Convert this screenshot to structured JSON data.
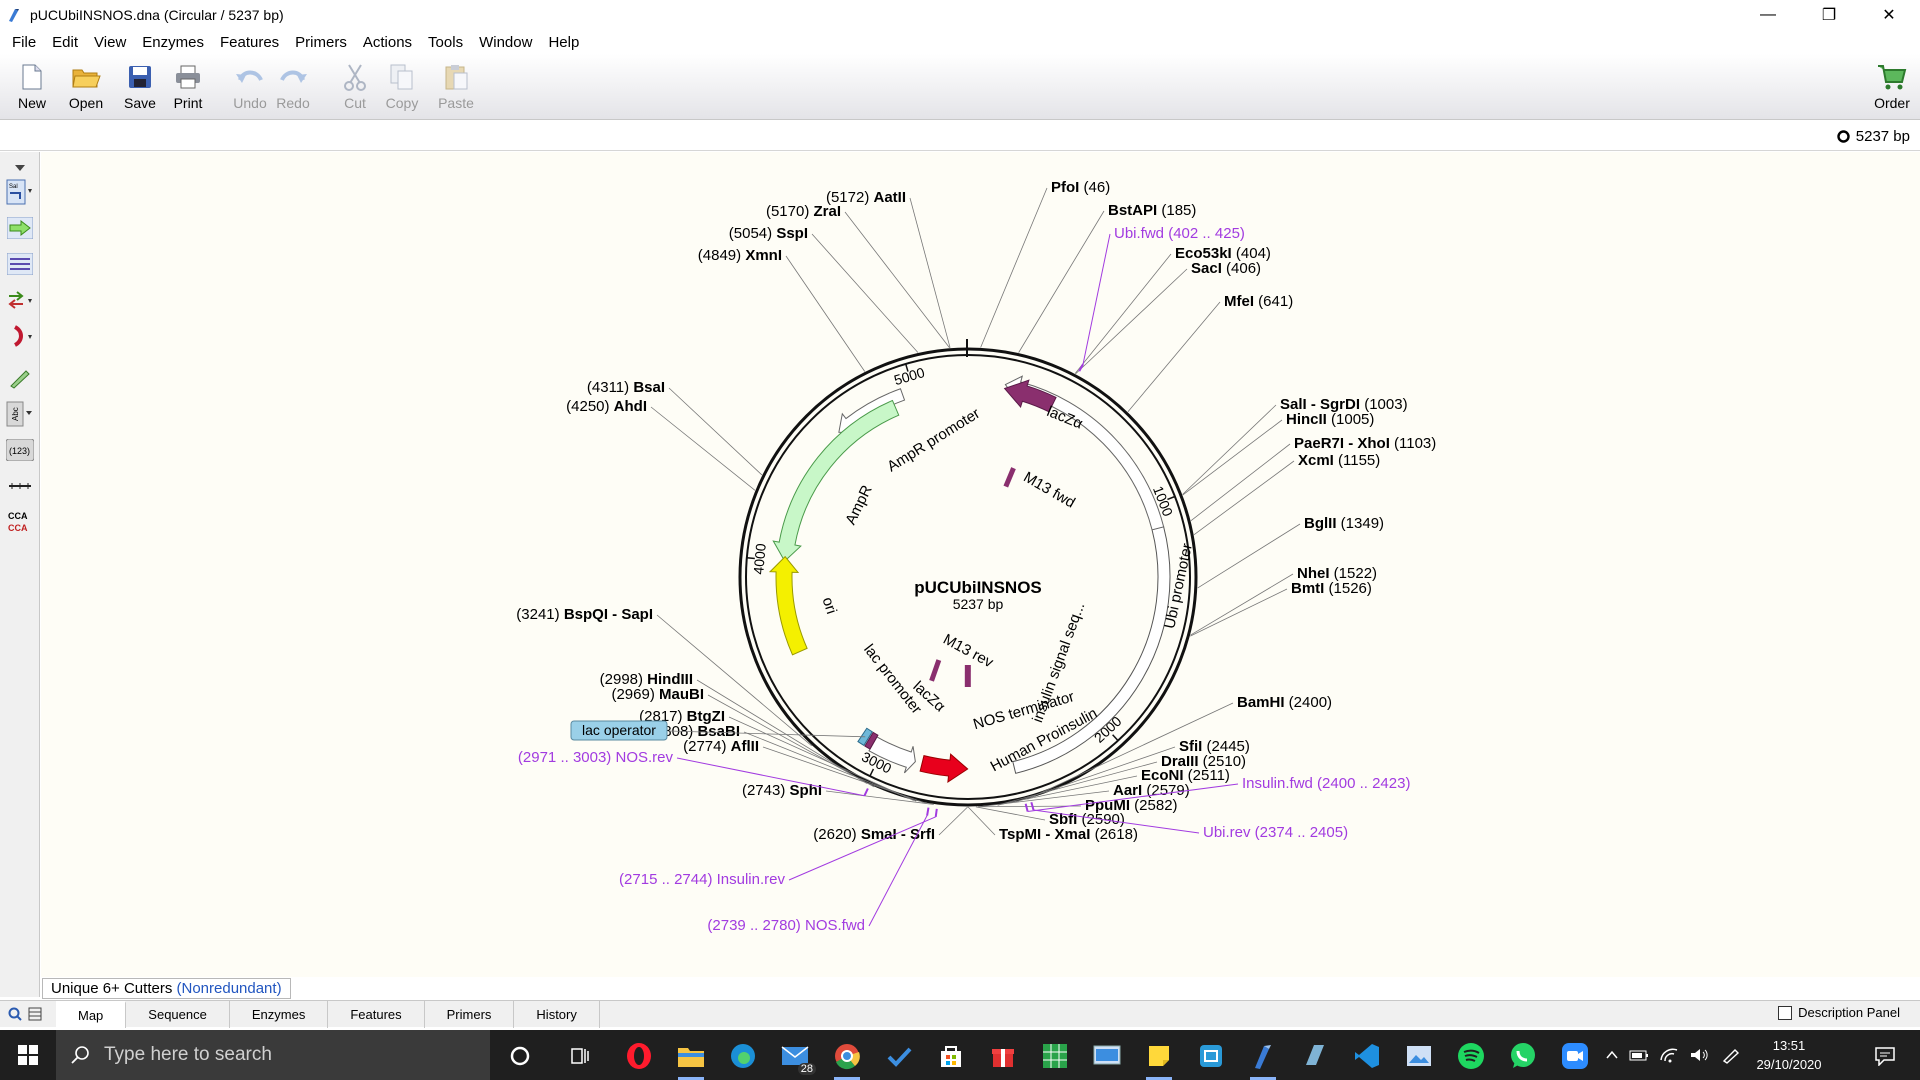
{
  "window": {
    "title": "pUCUbiINSNOS.dna  (Circular / 5237 bp)",
    "controls": [
      "—",
      "❐",
      "✕"
    ]
  },
  "menu": [
    "File",
    "Edit",
    "View",
    "Enzymes",
    "Features",
    "Primers",
    "Actions",
    "Tools",
    "Window",
    "Help"
  ],
  "toolbar": {
    "new": "New",
    "open": "Open",
    "save": "Save",
    "print": "Print",
    "undo": "Undo",
    "redo": "Redo",
    "cut": "Cut",
    "copy": "Copy",
    "paste": "Paste",
    "order": "Order"
  },
  "info": {
    "length": "5237 bp"
  },
  "left_tools": {
    "abc": "Abc",
    "num": "(123)",
    "cca_top": "CCA",
    "cca_bot": "CCA"
  },
  "map": {
    "name": "pUCUbiINSNOS",
    "length": "5237 bp",
    "ticks": [
      "1000",
      "2000",
      "3000",
      "4000",
      "5000"
    ],
    "features": {
      "lacZa_top": "lacZα",
      "m13fwd": "M13 fwd",
      "ubi_promoter": "Ubi promoter",
      "insulin_signal": "insulin signal seq...",
      "human_proinsulin": "Human Proinsulin",
      "nos_terminator": "NOS terminator",
      "m13rev": "M13 rev",
      "lacZa_bottom": "lacZα",
      "lac_promoter": "lac promoter",
      "ori": "ori",
      "ampr": "AmpR",
      "ampr_promoter": "AmpR promoter"
    },
    "sites": [
      {
        "name": "PfoI",
        "pos": "(46)"
      },
      {
        "name": "BstAPI",
        "pos": "(185)"
      },
      {
        "name": "Eco53kI",
        "pos": "(404)"
      },
      {
        "name": "SacI",
        "pos": "(406)"
      },
      {
        "name": "MfeI",
        "pos": "(641)"
      },
      {
        "name": "SalI - SgrDI",
        "pos": "(1003)"
      },
      {
        "name": "HincII",
        "pos": "(1005)"
      },
      {
        "name": "PaeR7I - XhoI",
        "pos": "(1103)"
      },
      {
        "name": "XcmI",
        "pos": "(1155)"
      },
      {
        "name": "BglII",
        "pos": "(1349)"
      },
      {
        "name": "NheI",
        "pos": "(1522)"
      },
      {
        "name": "BmtI",
        "pos": "(1526)"
      },
      {
        "name": "BamHI",
        "pos": "(2400)"
      },
      {
        "name": "SfiI",
        "pos": "(2445)"
      },
      {
        "name": "DraIII",
        "pos": "(2510)"
      },
      {
        "name": "EcoNI",
        "pos": "(2511)"
      },
      {
        "name": "AarI",
        "pos": "(2579)"
      },
      {
        "name": "PpuMI",
        "pos": "(2582)"
      },
      {
        "name": "SbfI",
        "pos": "(2590)"
      },
      {
        "name": "TspMI - XmaI",
        "pos": "(2618)"
      },
      {
        "name": "SmaI - SrfI",
        "pos": "(2620)"
      },
      {
        "name": "SphI",
        "pos": "(2743)"
      },
      {
        "name": "AflII",
        "pos": "(2774)"
      },
      {
        "name": "BsaBI",
        "pos": "(2808)"
      },
      {
        "name": "BtgZI",
        "pos": "(2817)"
      },
      {
        "name": "MauBI",
        "pos": "(2969)"
      },
      {
        "name": "HindIII",
        "pos": "(2998)"
      },
      {
        "name": "BspQI - SapI",
        "pos": "(3241)"
      },
      {
        "name": "AhdI",
        "pos": "(4250)"
      },
      {
        "name": "BsaI",
        "pos": "(4311)"
      },
      {
        "name": "XmnI",
        "pos": "(4849)"
      },
      {
        "name": "SspI",
        "pos": "(5054)"
      },
      {
        "name": "ZraI",
        "pos": "(5170)"
      },
      {
        "name": "AatII",
        "pos": "(5172)"
      }
    ],
    "primers": [
      {
        "name": "Ubi.fwd",
        "range": "(402 .. 425)"
      },
      {
        "name": "Insulin.fwd",
        "range": "(2400 .. 2423)"
      },
      {
        "name": "Ubi.rev",
        "range": "(2374 .. 2405)"
      },
      {
        "name": "NOS.rev",
        "range": "(2971 .. 3003)"
      },
      {
        "name": "Insulin.rev",
        "range": "(2715 .. 2744)"
      },
      {
        "name": "NOS.fwd",
        "range": "(2739 .. 2780)"
      }
    ],
    "lac_operator": "lac operator"
  },
  "cutters": {
    "label": "Unique 6+ Cutters",
    "sub": "(Nonredundant)"
  },
  "tabs": [
    "Map",
    "Sequence",
    "Enzymes",
    "Features",
    "Primers",
    "History"
  ],
  "description_panel": "Description Panel",
  "taskbar": {
    "search_placeholder": "Type here to search",
    "mail_badge": "28",
    "time": "13:51",
    "date": "29/10/2020"
  },
  "colors": {
    "primer": "#a23be0",
    "ori": "#f4f000",
    "ampr": "#c8f7c8",
    "lacz": "#8a2f6e",
    "proinsulin": "#e8001c",
    "operator": "#9ad0e8"
  }
}
